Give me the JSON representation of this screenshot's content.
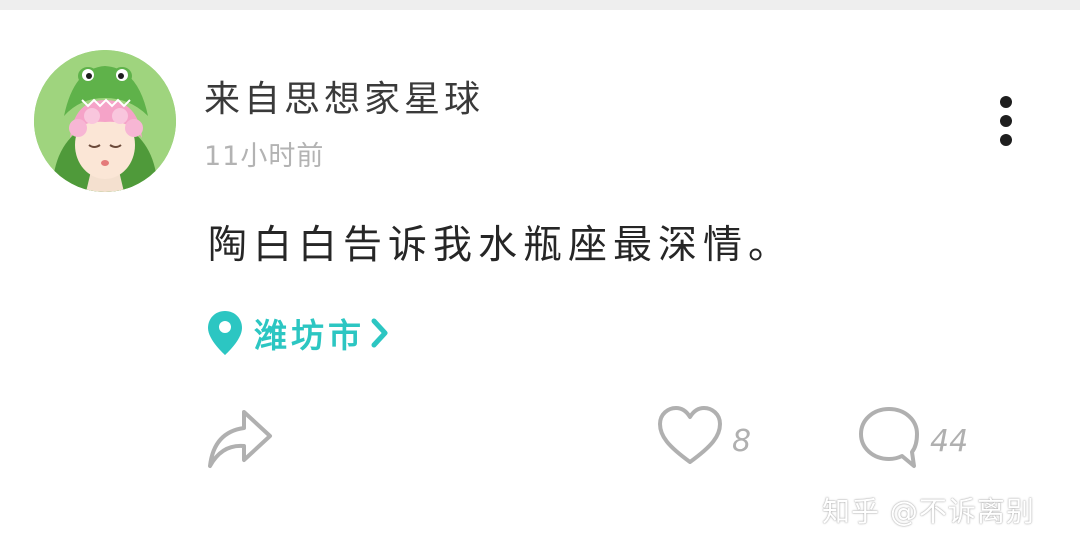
{
  "post": {
    "username": "来自思想家星球",
    "timestamp": "11小时前",
    "text": "陶白白告诉我水瓶座最深情。",
    "location": "潍坊市"
  },
  "actions": {
    "like_count": "8",
    "comment_count": "44"
  },
  "watermark": "知乎 @不诉离别",
  "icons": {
    "more": "more-vertical-icon",
    "location": "location-pin-icon",
    "chevron": "chevron-right-icon",
    "share": "share-icon",
    "like": "heart-icon",
    "comment": "comment-bubble-icon"
  },
  "colors": {
    "accent": "#2cc6c2",
    "text": "#262626",
    "muted": "#b0b0b0"
  }
}
